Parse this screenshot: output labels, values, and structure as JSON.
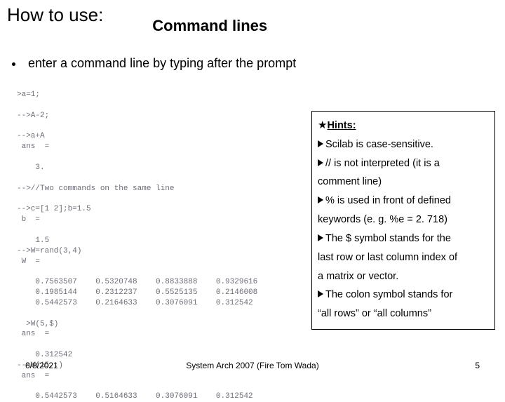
{
  "title": {
    "how_to": "How to use:",
    "command_lines": "Command lines"
  },
  "bullet": {
    "item1": "enter a command line by typing after the prompt"
  },
  "console": ">a=1;\n\n-->A-2;\n\n-->a+A\n ans  =\n\n    3.\n\n-->//Two commands on the same line\n\n-->c=[1 2];b=1.5\n b  =\n\n    1.5\n-->W=rand(3,4)\n W  =\n\n    0.7563507    0.5320748    0.8833888    0.9329616\n    0.1985144    0.2312237    0.5525135    0.2146008\n    0.5442573    0.2164633    0.3076091    0.312542\n\n  >W(5,$)\n ans  =\n\n    0.312542\n-->W(15,:)\n ans  =\n\n    0.5442573    0.5164633    0.3076091    0.312542",
  "hints": {
    "heading": "Hints:",
    "i1": "Scilab is case-sensitive.",
    "i2": "// is not interpreted (it is a",
    "i2b": "comment line)",
    "i3": "% is used in front of defined",
    "i3b": "keywords (e. g. %e = 2. 718)",
    "i4": "The $ symbol stands for the",
    "i4b": "last row or last column index of",
    "i4c": "a matrix or vector.",
    "i5": "The colon symbol stands for",
    "i5b": "“all rows” or “all columns”"
  },
  "footer": {
    "date": "6/8/2021",
    "center": "System Arch 2007  (Fire Tom Wada)",
    "page": "5"
  }
}
